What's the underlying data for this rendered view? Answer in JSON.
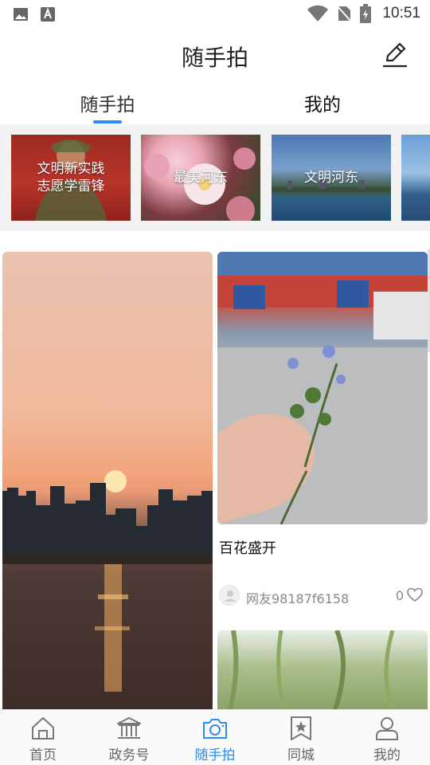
{
  "status_bar": {
    "time": "10:51"
  },
  "header": {
    "title": "随手拍"
  },
  "tabs": [
    {
      "label": "随手拍",
      "active": true
    },
    {
      "label": "我的",
      "active": false
    }
  ],
  "topics": [
    {
      "label": "文明新实践\n志愿学雷锋"
    },
    {
      "label": "最美河东"
    },
    {
      "label": "文明河东"
    },
    {
      "label": ""
    }
  ],
  "feed": {
    "right_card": {
      "title": "百花盛开",
      "author": "网友98187f6158",
      "likes": "0"
    }
  },
  "bottom_nav": [
    {
      "label": "首页",
      "icon": "home-icon",
      "active": false
    },
    {
      "label": "政务号",
      "icon": "government-icon",
      "active": false
    },
    {
      "label": "随手拍",
      "icon": "camera-icon",
      "active": true
    },
    {
      "label": "同城",
      "icon": "star-bookmark-icon",
      "active": false
    },
    {
      "label": "我的",
      "icon": "user-icon",
      "active": false
    }
  ],
  "colors": {
    "accent": "#2a8cf0",
    "text_muted": "#888888"
  }
}
